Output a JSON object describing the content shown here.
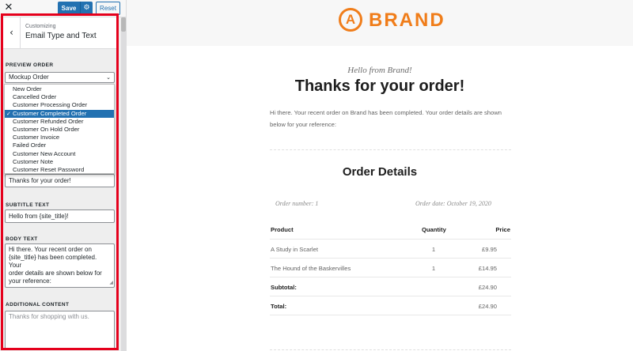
{
  "topbar": {
    "close_glyph": "✕",
    "save_label": "Save",
    "gear_glyph": "⚙",
    "reset_label": "Reset"
  },
  "section": {
    "back_glyph": "‹",
    "pre_title": "Customizing",
    "title": "Email Type and Text"
  },
  "preview_order": {
    "label": "PREVIEW ORDER",
    "selected": "Mockup Order",
    "chevron": "⌄"
  },
  "dropdown": {
    "options": [
      "New Order",
      "Cancelled Order",
      "Customer Processing Order",
      "Customer Completed Order",
      "Customer Refunded Order",
      "Customer On Hold Order",
      "Customer Invoice",
      "Failed Order",
      "Customer New Account",
      "Customer Note",
      "Customer Reset Password"
    ],
    "checked_index": 3,
    "check_glyph": "✓"
  },
  "fields": {
    "heading_value": "Thanks for your order!",
    "subtitle_label": "SUBTITLE TEXT",
    "subtitle_value": "Hello from {site_title}!",
    "body_label": "BODY TEXT",
    "body_value": "Hi there. Your recent order on\n{site_title} has been completed. Your\norder details are shown below for\nyour reference:",
    "additional_label": "ADDITIONAL CONTENT",
    "additional_placeholder": "Thanks for shopping with us."
  },
  "preview": {
    "brand_letter": "A",
    "brand_name": "BRAND",
    "brand_color": "#f07d1a",
    "hello": "Hello from Brand!",
    "thanks": "Thanks for your order!",
    "intro": "Hi there. Your recent order on Brand has been completed. Your order details are shown below for your reference:",
    "details_title": "Order Details",
    "order_number": "Order number: 1",
    "order_date": "Order date: October 19, 2020",
    "table": {
      "headers": [
        "Product",
        "Quantity",
        "Price"
      ],
      "rows": [
        {
          "product": "A Study in Scarlet",
          "qty": "1",
          "price": "£9.95"
        },
        {
          "product": "The Hound of the Baskervilles",
          "qty": "1",
          "price": "£14.95"
        }
      ],
      "subtotal_label": "Subtotal:",
      "subtotal_value": "£24.90",
      "total_label": "Total:",
      "total_value": "£24.90"
    }
  }
}
